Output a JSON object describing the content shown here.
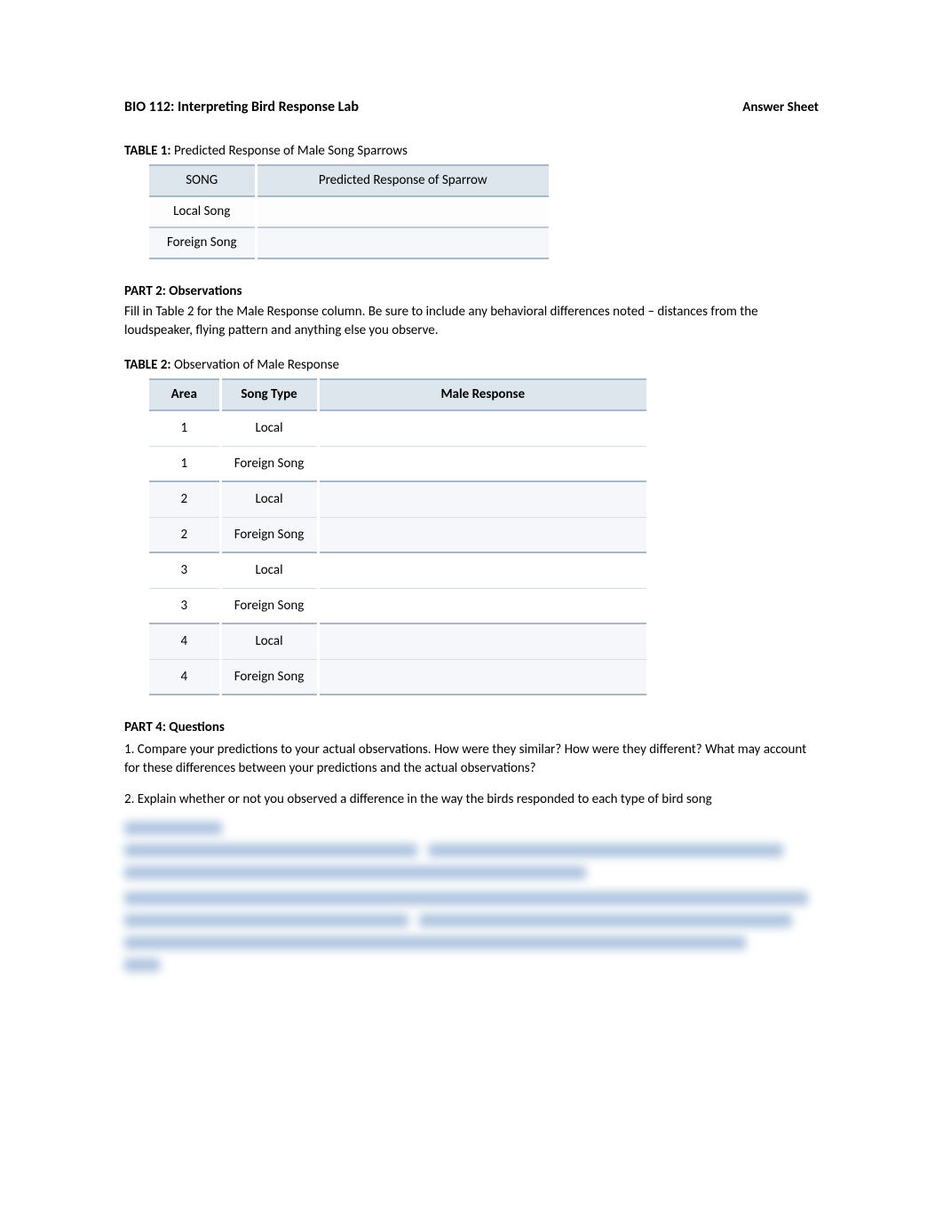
{
  "header": {
    "title": "BIO 112: Interpreting Bird Response Lab",
    "right_label": "Answer Sheet"
  },
  "table1": {
    "label_bold": "TABLE 1:",
    "label_rest": " Predicted Response of Male Song Sparrows",
    "headers": [
      "SONG",
      "Predicted Response of Sparrow"
    ],
    "rows": [
      {
        "song": "Local Song",
        "response": ""
      },
      {
        "song": "Foreign Song",
        "response": ""
      }
    ]
  },
  "part2": {
    "heading": "PART 2: Observations",
    "text": "Fill in Table 2 for the Male Response column. Be sure to include any behavioral differences noted – distances from the loudspeaker, flying pattern and anything else you observe."
  },
  "table2": {
    "label_bold": "TABLE 2:",
    "label_rest": " Observation of Male Response",
    "headers": [
      "Area",
      "Song Type",
      "Male Response"
    ],
    "rows": [
      {
        "area": "1",
        "type": "Local",
        "response": ""
      },
      {
        "area": "1",
        "type": "Foreign Song",
        "response": ""
      },
      {
        "area": "2",
        "type": "Local",
        "response": ""
      },
      {
        "area": "2",
        "type": "Foreign Song",
        "response": ""
      },
      {
        "area": "3",
        "type": "Local",
        "response": ""
      },
      {
        "area": "3",
        "type": "Foreign Song",
        "response": ""
      },
      {
        "area": "4",
        "type": "Local",
        "response": ""
      },
      {
        "area": "4",
        "type": "Foreign Song",
        "response": ""
      }
    ]
  },
  "part4": {
    "heading": "PART 4: Questions",
    "q1": "1.  Compare your predictions to your actual observations. How were they similar?   How were they different? What may account for these differences between your predictions and the actual observations?",
    "q2": "2.  Explain whether or not you observed a difference in the way the birds responded to each type of bird song"
  }
}
